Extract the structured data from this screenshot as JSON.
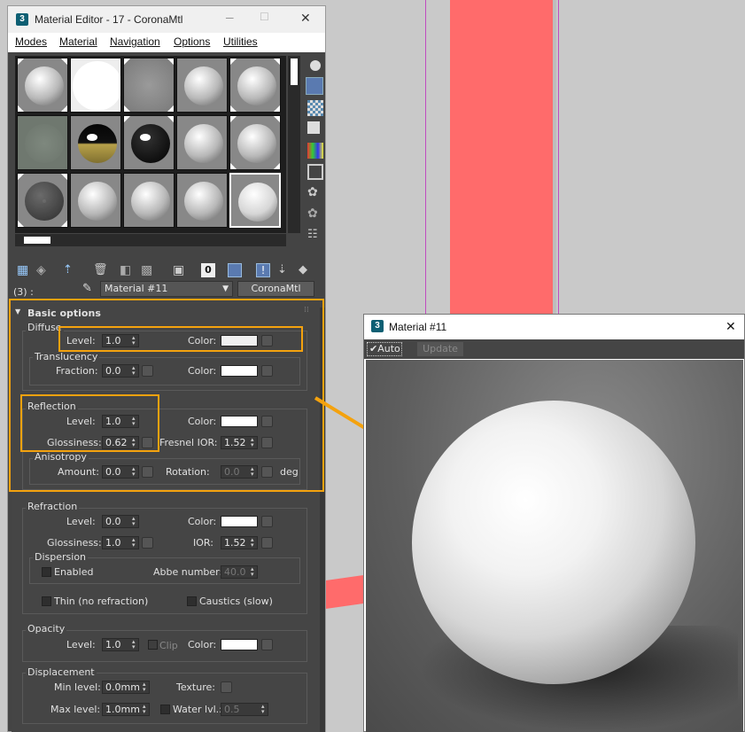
{
  "editor": {
    "title": "Material Editor - 17 - CoronaMtl",
    "app_icon": "3",
    "menus": [
      "Modes",
      "Material",
      "Navigation",
      "Options",
      "Utilities"
    ],
    "slot_label": "(3) :",
    "material_name": "Material #11",
    "material_type": "CoronaMtl"
  },
  "basic": {
    "rollout_title": "Basic options",
    "diffuse": {
      "title": "Diffuse",
      "level_label": "Level:",
      "level": "1.0",
      "color_label": "Color:"
    },
    "translucency": {
      "title": "Translucency",
      "fraction_label": "Fraction:",
      "fraction": "0.0",
      "color_label": "Color:"
    },
    "reflection": {
      "title": "Reflection",
      "level_label": "Level:",
      "level": "1.0",
      "color_label": "Color:",
      "gloss_label": "Glossiness:",
      "gloss": "0.62",
      "fresnel_label": "Fresnel IOR:",
      "fresnel": "1.52"
    },
    "anisotropy": {
      "title": "Anisotropy",
      "amount_label": "Amount:",
      "amount": "0.0",
      "rotation_label": "Rotation:",
      "rotation": "0.0",
      "deg": "deg"
    },
    "refraction": {
      "title": "Refraction",
      "level_label": "Level:",
      "level": "0.0",
      "color_label": "Color:",
      "gloss_label": "Glossiness:",
      "gloss": "1.0",
      "ior_label": "IOR:",
      "ior": "1.52"
    },
    "dispersion": {
      "title": "Dispersion",
      "enabled": "Enabled",
      "abbe_label": "Abbe number:",
      "abbe": "40.0"
    },
    "thin": "Thin (no refraction)",
    "caustics": "Caustics (slow)",
    "opacity": {
      "title": "Opacity",
      "level_label": "Level:",
      "level": "1.0",
      "clip": "Clip",
      "color_label": "Color:"
    },
    "displacement": {
      "title": "Displacement",
      "min_label": "Min level:",
      "min": "0.0mm",
      "texture_label": "Texture:",
      "max_label": "Max level:",
      "max": "1.0mm",
      "water_label": "Water lvl.:",
      "water": "0.5"
    }
  },
  "preview": {
    "app_icon": "3",
    "title": "Material #11",
    "close": "✕",
    "auto_label": "Auto",
    "update_label": "Update"
  },
  "window_controls": {
    "minimize": "─",
    "maximize": "☐",
    "close": "✕"
  },
  "colors": {
    "accent": "#f4a20e",
    "red": "#ff6b6b"
  }
}
